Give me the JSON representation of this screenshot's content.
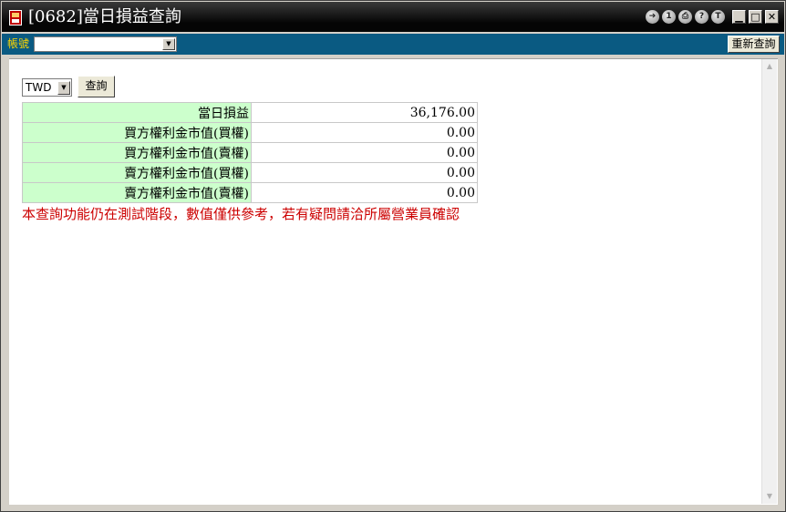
{
  "window": {
    "title": "[0682]當日損益查詢",
    "title_buttons": [
      {
        "icon": "forward-icon",
        "glyph": "➔"
      },
      {
        "icon": "info-icon",
        "glyph": "1"
      },
      {
        "icon": "print-icon",
        "glyph": "⎙"
      },
      {
        "icon": "help-icon",
        "glyph": "?"
      },
      {
        "icon": "t-icon",
        "glyph": "T"
      }
    ],
    "min_glyph": "▁",
    "max_glyph": "□",
    "close_glyph": "✕"
  },
  "account_bar": {
    "label": "帳號",
    "account_value": "",
    "reload_label": "重新查詢"
  },
  "query": {
    "currency": "TWD",
    "button_label": "查詢"
  },
  "pl_table": {
    "rows": [
      {
        "label": "當日損益",
        "value": "36,176.00"
      },
      {
        "label": "買方權利金市值(買權)",
        "value": "0.00"
      },
      {
        "label": "買方權利金市值(賣權)",
        "value": "0.00"
      },
      {
        "label": "賣方權利金市值(買權)",
        "value": "0.00"
      },
      {
        "label": "賣方權利金市值(賣權)",
        "value": "0.00"
      }
    ]
  },
  "notice": "本查詢功能仍在測試階段，數值僅供參考，若有疑問請洽所屬營業員確認",
  "colors": {
    "label_bg": "#ccffcc",
    "notice": "#cc0000",
    "account_bar_bg": "#0a5a82",
    "account_label": "#ffd700"
  }
}
